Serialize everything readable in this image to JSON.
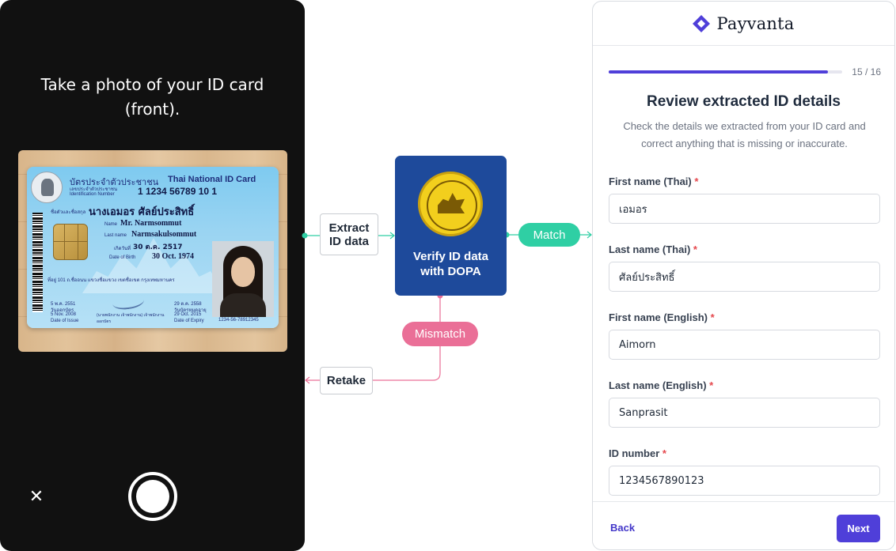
{
  "camera": {
    "instruction": "Take a photo of your ID card\n(front).",
    "close_icon": "close-icon",
    "shutter_icon": "shutter-button"
  },
  "id_card": {
    "thai_title": "บัตรประจำตัวประชาชน",
    "english_title": "Thai National ID Card",
    "id_label": "เลขประจำตัวประชาชน Identification Number",
    "id_number": "1 1234 56789 10 1",
    "name_label": "ชื่อตัวและชื่อสกุล",
    "thai_name": "นางเอมอร ศัลย์ประสิทธิ์",
    "name_en_label": "Name",
    "name_en": "Mr. Narmsommut",
    "lastname_en_label": "Last name",
    "lastname_en": "Narmsakulsommut",
    "dob_th_label": "เกิดวันที่",
    "dob_th": "30 ต.ค. 2517",
    "dob_en_label": "Date of Birth",
    "dob_en": "30 Oct. 1974",
    "address": "ที่อยู่ 101 ถ.ชื่ออนน แขวงชื่อแขวง เขตชื่อเขต กรุงเทพมหานคร",
    "issue_th": "5 พ.ค. 2551",
    "issue_th_label": "วันออกบัตร",
    "issue_en": "5 Nov. 2008",
    "issue_en_label": "Date of Issue",
    "expiry_th": "29 ต.ค. 2558",
    "expiry_th_label": "วันบัตรหมดอายุ",
    "expiry_en": "29 Oct. 2015",
    "expiry_en_label": "Date of Expiry",
    "officer": "(นายพนักงาน เจ้าพนักงาน) เจ้าพนักงานออกบัตร",
    "photo_code": "1234-56-78912345"
  },
  "flow": {
    "extract_label": "Extract\nID data",
    "verify_label": "Verify ID data\nwith DOPA",
    "seal_icon": "dopa-seal-icon",
    "match_label": "Match",
    "mismatch_label": "Mismatch",
    "retake_label": "Retake",
    "match_color": "#2fcfa4",
    "mismatch_color": "#ea6f97",
    "dopa_color": "#1e4a9b"
  },
  "form": {
    "brand_name": "Payvanta",
    "brand_icon": "payvanta-diamond-icon",
    "progress_value": 0.94,
    "progress_text": "15 / 16",
    "title": "Review extracted ID details",
    "description": "Check the details we extracted from your ID card and correct anything that is missing or inaccurate.",
    "fields": [
      {
        "label": "First name (Thai)",
        "required": "*",
        "value": "เอมอร"
      },
      {
        "label": "Last name (Thai)",
        "required": "*",
        "value": "ศัลย์ประสิทธิ์"
      },
      {
        "label": "First name (English)",
        "required": "*",
        "value": "Aimorn"
      },
      {
        "label": "Last name (English)",
        "required": "*",
        "value": "Sanprasit"
      },
      {
        "label": "ID number",
        "required": "*",
        "value": "1234567890123"
      }
    ],
    "back_label": "Back",
    "next_label": "Next",
    "accent": "#4f3fd9"
  }
}
